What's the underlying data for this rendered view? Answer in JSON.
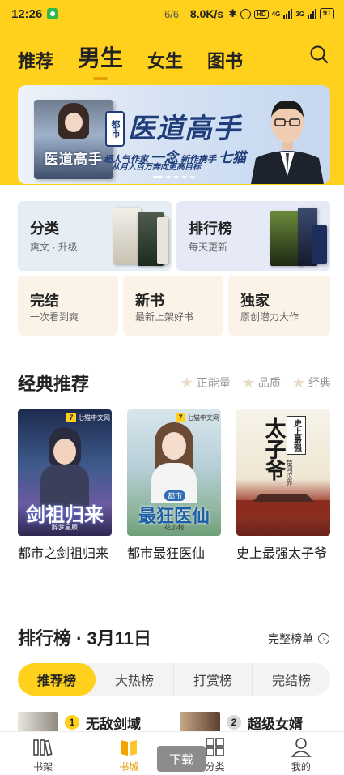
{
  "status_bar": {
    "time": "12:26",
    "page_indicator": "6/6",
    "net_speed": "8.0K/s",
    "signal_1": "4G",
    "signal_2": "3G",
    "battery": "91"
  },
  "top_tabs": [
    {
      "label": "推荐",
      "active": false
    },
    {
      "label": "男生",
      "active": true
    },
    {
      "label": "女生",
      "active": false
    },
    {
      "label": "图书",
      "active": false
    }
  ],
  "banner": {
    "tag": "都市",
    "title": "医道高手",
    "book_cover_title": "医道高手",
    "line1_a": "超人气作家",
    "line1_author": "一念",
    "line1_b": "新作携手",
    "line1_brand": "七猫",
    "line2": "从月入百万奔向更高目标"
  },
  "category_cards": [
    {
      "title": "分类",
      "sub": "爽文 · 升级"
    },
    {
      "title": "排行榜",
      "sub": "每天更新"
    },
    {
      "title": "完结",
      "sub": "一次看到爽"
    },
    {
      "title": "新书",
      "sub": "最新上架好书"
    },
    {
      "title": "独家",
      "sub": "原创潜力大作"
    }
  ],
  "classic": {
    "title": "经典推荐",
    "filters": [
      "正能量",
      "品质",
      "经典"
    ],
    "books": [
      {
        "name": "都市之剑祖归来",
        "cover_title": "剑祖归来",
        "cover_badge": "七猫中文网",
        "cover_author": "醉梦星辰"
      },
      {
        "name": "都市最狂医仙",
        "cover_title": "最狂医仙",
        "cover_badge": "七猫中文网",
        "cover_tag": "都市",
        "cover_author": "花小刺"
      },
      {
        "name": "史上最强太子爷",
        "cover_title": "太子爷",
        "cover_side": "史上最强",
        "cover_author": "楚河汉界"
      }
    ]
  },
  "ranking": {
    "title": "排行榜 · 3月11日",
    "more": "完整榜单",
    "tabs": [
      {
        "label": "推荐榜",
        "active": true
      },
      {
        "label": "大热榜",
        "active": false
      },
      {
        "label": "打赏榜",
        "active": false
      },
      {
        "label": "完结榜",
        "active": false
      }
    ],
    "items": [
      {
        "rank": "1",
        "name": "无敌剑域"
      },
      {
        "rank": "2",
        "name": "超级女婿"
      }
    ]
  },
  "bottom_nav": [
    {
      "label": "书架",
      "icon": "bookshelf-icon",
      "active": false
    },
    {
      "label": "书城",
      "icon": "bookstore-icon",
      "active": true
    },
    {
      "label": "分类",
      "icon": "grid-icon",
      "active": false
    },
    {
      "label": "我的",
      "icon": "profile-icon",
      "active": false
    }
  ],
  "download_label": "下载",
  "colors": {
    "accent_yellow": "#ffd11c",
    "accent_orange": "#e39b00",
    "banner_navy": "#1f3d7a"
  }
}
